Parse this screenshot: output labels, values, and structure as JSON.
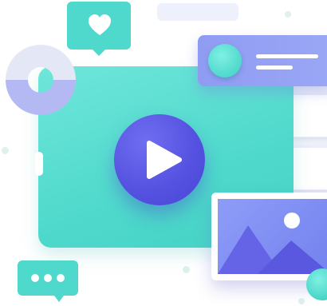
{
  "illustration": {
    "theme": "video-content-illustration",
    "icons": {
      "play": "play-icon",
      "heart": "heart-icon",
      "chat": "chat-dots-icon",
      "image": "image-icon",
      "avatar": "avatar-icon"
    },
    "colors": {
      "teal": "#4fd9cc",
      "teal_light": "#6fe6da",
      "indigo": "#5450e0",
      "periwinkle": "#8f9cf2",
      "lavender": "#b7bdf5",
      "white": "#ffffff"
    }
  }
}
